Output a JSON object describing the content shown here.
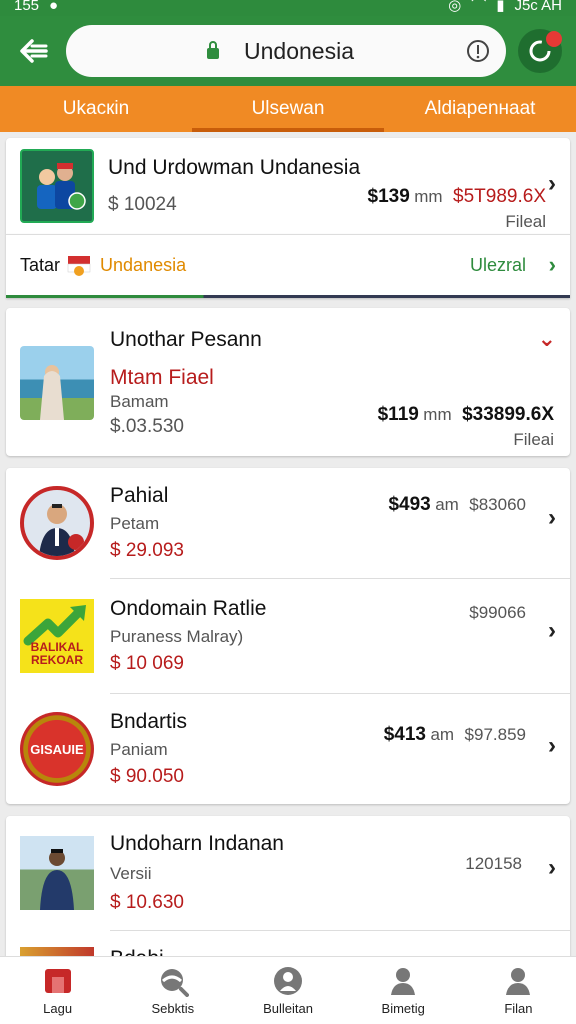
{
  "status": {
    "time": "155",
    "clock": "J5c AH"
  },
  "urlbar": {
    "text": "Undonesia"
  },
  "tabs": [
    {
      "label": "Ukacкin"
    },
    {
      "label": "Ulsewan"
    },
    {
      "label": "Aldiapenнaat"
    }
  ],
  "top_item": {
    "title": "Und Urdowman Undanesia",
    "amount": "$ 10024",
    "price_left": "$139",
    "price_unit": "mm",
    "price_right": "$5T989.6X",
    "note": "Fileal"
  },
  "filter_bar": {
    "left": "Tatar",
    "country": "Undanesia",
    "right": "Ulezral"
  },
  "item2": {
    "title": "Unothar Pesann",
    "highlight": "Mtam Fiael",
    "sub": "Bamam",
    "amount": "$.03.530",
    "price_left": "$119",
    "price_unit": "mm",
    "price_right": "$33899.6X",
    "note": "Fileai"
  },
  "list_a": [
    {
      "title": "Pahial",
      "sub": "Petam",
      "price": "$ 29.093",
      "p1": "$493",
      "unit": "am",
      "p2": "$83060"
    },
    {
      "title": "Ondomain Ratlie",
      "sub": "Puraness Malray)",
      "price": "$ 10 069",
      "p1": "",
      "unit": "",
      "p2": "$99066",
      "logo_text": "BALIKAL REKOAR"
    },
    {
      "title": "Bndartis",
      "sub": "Paniam",
      "price": "$ 90.050",
      "p1": "$413",
      "unit": "am",
      "p2": "$97.859",
      "logo_text": "GISAUIE"
    }
  ],
  "list_b": [
    {
      "title": "Undoharn Indanan",
      "sub": "Versii",
      "price": "$ 10.630",
      "p2": "120158"
    },
    {
      "title": "Bdahi"
    }
  ],
  "bottom_nav": [
    {
      "label": "Lagu"
    },
    {
      "label": "Sebktis"
    },
    {
      "label": "Bulleitan"
    },
    {
      "label": "Bimetig"
    },
    {
      "label": "Filan"
    }
  ],
  "colors": {
    "green": "#2f8d3e",
    "orange": "#f08a24",
    "red": "#b71c1c"
  }
}
